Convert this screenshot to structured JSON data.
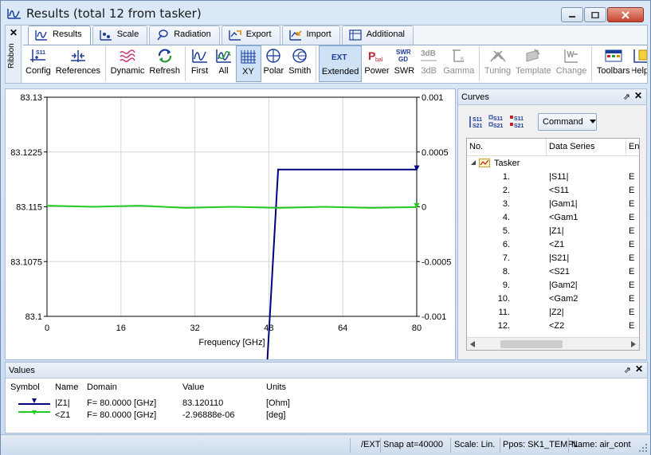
{
  "window": {
    "title": "Results (total 12 from tasker)"
  },
  "ribbon": {
    "side_label": "Ribbon",
    "tabs": [
      {
        "label": "Results",
        "active": true
      },
      {
        "label": "Scale",
        "active": false
      },
      {
        "label": "Radiation",
        "active": false
      },
      {
        "label": "Export",
        "active": false
      },
      {
        "label": "Import",
        "active": false
      },
      {
        "label": "Additional",
        "active": false
      }
    ],
    "buttons": [
      {
        "label": "Config",
        "icon": "s11-config-icon",
        "enabled": true
      },
      {
        "label": "References",
        "icon": "references-icon",
        "enabled": true
      },
      {
        "label": "Dynamic",
        "icon": "dynamic-wave-icon",
        "enabled": true
      },
      {
        "label": "Refresh",
        "icon": "refresh-icon",
        "enabled": true
      },
      {
        "label": "First",
        "icon": "first-chart-icon",
        "enabled": true
      },
      {
        "label": "All",
        "icon": "all-charts-icon",
        "enabled": true
      },
      {
        "label": "XY",
        "icon": "xy-grid-icon",
        "enabled": true,
        "selected": true
      },
      {
        "label": "Polar",
        "icon": "polar-icon",
        "enabled": true
      },
      {
        "label": "Smith",
        "icon": "smith-chart-icon",
        "enabled": true
      },
      {
        "label": "Extended",
        "icon": "ext-icon",
        "enabled": true,
        "selected": true
      },
      {
        "label": "Power",
        "icon": "pbal-icon",
        "enabled": true
      },
      {
        "label": "SWR",
        "icon": "swr-gd-icon",
        "enabled": true
      },
      {
        "label": "3dB",
        "icon": "3db-icon",
        "enabled": false
      },
      {
        "label": "Gamma",
        "icon": "gamma-icon",
        "enabled": false
      },
      {
        "label": "Tuning",
        "icon": "tuning-icon",
        "enabled": false
      },
      {
        "label": "Template",
        "icon": "template-icon",
        "enabled": false
      },
      {
        "label": "Change",
        "icon": "change-icon",
        "enabled": false
      },
      {
        "label": "Toolbars",
        "icon": "toolbars-icon",
        "enabled": true
      },
      {
        "label": "Help",
        "icon": "help-icon",
        "enabled": true
      }
    ]
  },
  "chart_data": {
    "type": "line",
    "xlabel": "Frequency [GHz]",
    "xlim": [
      0,
      80
    ],
    "x_ticks": [
      "0",
      "16",
      "32",
      "48",
      "64",
      "80"
    ],
    "ylim_left": [
      83.1,
      83.13
    ],
    "y_ticks_left": [
      "83.13",
      "83.1225",
      "83.115",
      "83.1075",
      "83.1"
    ],
    "ylim_right": [
      -0.001,
      0.001
    ],
    "y_ticks_right": [
      "0.001",
      "0.0005",
      "0",
      "-0.0005",
      "-0.001"
    ],
    "grid": true,
    "series": [
      {
        "name": "|Z1|",
        "color": "#000080",
        "axis": "left",
        "x": [
          47.5,
          50.0,
          50.0,
          80.0
        ],
        "y": [
          83.092,
          83.12,
          83.12011,
          83.12011
        ]
      },
      {
        "name": "<Z1",
        "color": "#22cc22",
        "axis": "right",
        "x": [
          0,
          10,
          20,
          30,
          40,
          50,
          60,
          70,
          80
        ],
        "y": [
          1e-05,
          0.0,
          1e-05,
          -1e-05,
          0.0,
          -1e-05,
          0.0,
          -1e-05,
          -3e-06
        ]
      }
    ]
  },
  "curves": {
    "title": "Curves",
    "command_label": "Command",
    "columns": [
      "No.",
      "Data Series",
      "En"
    ],
    "root": "Tasker",
    "items": [
      {
        "no": "1.",
        "series": "|S11|",
        "en": "E"
      },
      {
        "no": "2.",
        "series": "<S11",
        "en": "E"
      },
      {
        "no": "3.",
        "series": "|Gam1|",
        "en": "E"
      },
      {
        "no": "4.",
        "series": "<Gam1",
        "en": "E"
      },
      {
        "no": "5.",
        "series": "|Z1|",
        "en": "E"
      },
      {
        "no": "6.",
        "series": "<Z1",
        "en": "E"
      },
      {
        "no": "7.",
        "series": "|S21|",
        "en": "E"
      },
      {
        "no": "8.",
        "series": "<S21",
        "en": "E"
      },
      {
        "no": "9.",
        "series": "|Gam2|",
        "en": "E"
      },
      {
        "no": "10.",
        "series": "<Gam2",
        "en": "E"
      },
      {
        "no": "11.",
        "series": "|Z2|",
        "en": "E"
      },
      {
        "no": "12.",
        "series": "<Z2",
        "en": "E"
      }
    ]
  },
  "values": {
    "title": "Values",
    "columns": [
      "Symbol",
      "Name",
      "Domain",
      "Value",
      "Units"
    ],
    "rows": [
      {
        "name": "|Z1|",
        "domain": "F= 80.0000 [GHz]",
        "value": "83.120110",
        "units": "[Ohm]",
        "color": "#000080"
      },
      {
        "name": "<Z1",
        "domain": "F= 80.0000 [GHz]",
        "value": "-2.96888e-06",
        "units": "[deg]",
        "color": "#22cc22"
      }
    ]
  },
  "status": {
    "mode": "/EXT",
    "snap": "Snap at=40000",
    "scale": "Scale: Lin.",
    "ppos": "Ppos: SK1_TEMPL",
    "name": "Name: air_cont"
  }
}
